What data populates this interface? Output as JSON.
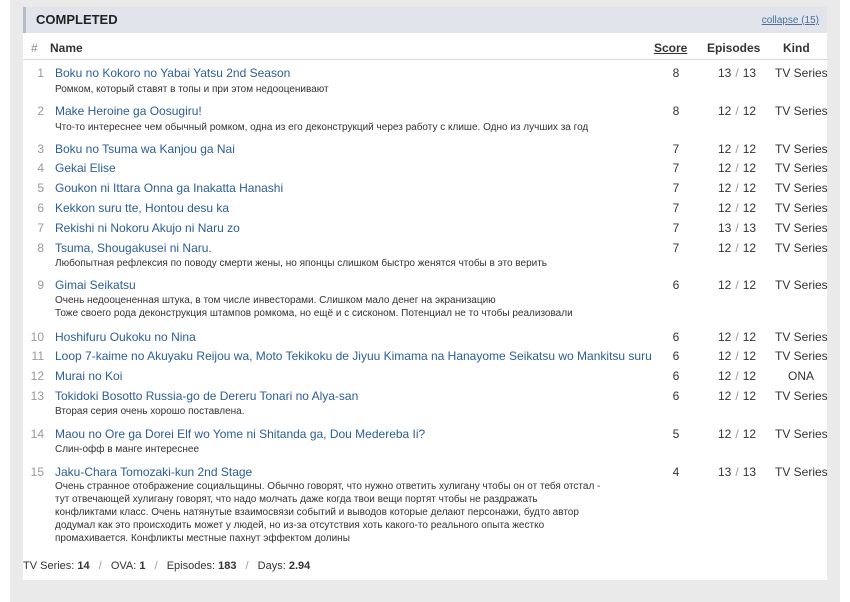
{
  "section": {
    "title": "COMPLETED",
    "collapse_label": "collapse (15)"
  },
  "columns": {
    "num": "#",
    "name": "Name",
    "score": "Score",
    "episodes": "Episodes",
    "kind": "Kind"
  },
  "episodes_sep": "/",
  "rows": [
    {
      "num": "1",
      "name": "Boku no Kokoro no Yabai Yatsu 2nd Season",
      "comment": "Ромком, который ставят в топы и при этом недооценивают",
      "score": "8",
      "watched": "13",
      "total": "13",
      "kind": "TV Series"
    },
    {
      "num": "2",
      "name": "Make Heroine ga Oosugiru!",
      "comment": "Что-то интереснее чем обычный ромком, одна из его деконструкций через работу с клише. Одно из лучших за год",
      "score": "8",
      "watched": "12",
      "total": "12",
      "kind": "TV Series"
    },
    {
      "num": "3",
      "name": "Boku no Tsuma wa Kanjou ga Nai",
      "comment": "",
      "score": "7",
      "watched": "12",
      "total": "12",
      "kind": "TV Series"
    },
    {
      "num": "4",
      "name": "Gekai Elise",
      "comment": "",
      "score": "7",
      "watched": "12",
      "total": "12",
      "kind": "TV Series"
    },
    {
      "num": "5",
      "name": "Goukon ni Ittara Onna ga Inakatta Hanashi",
      "comment": "",
      "score": "7",
      "watched": "12",
      "total": "12",
      "kind": "TV Series"
    },
    {
      "num": "6",
      "name": "Kekkon suru tte, Hontou desu ka",
      "comment": "",
      "score": "7",
      "watched": "12",
      "total": "12",
      "kind": "TV Series"
    },
    {
      "num": "7",
      "name": "Rekishi ni Nokoru Akujo ni Naru zo",
      "comment": "",
      "score": "7",
      "watched": "13",
      "total": "13",
      "kind": "TV Series"
    },
    {
      "num": "8",
      "name": "Tsuma, Shougakusei ni Naru.",
      "comment": "Любопытная рефлексия по поводу смерти жены, но японцы слишком быстро женятся чтобы в это верить",
      "score": "7",
      "watched": "12",
      "total": "12",
      "kind": "TV Series"
    },
    {
      "num": "9",
      "name": "Gimai Seikatsu",
      "comment": "Очень недооцененная штука, в том числе инвесторами. Слишком мало денег на экранизацию\nТоже своего рода деконструкция штампов ромкома, но ещё и с сисконом. Потенциал не то чтобы реализовали",
      "score": "6",
      "watched": "12",
      "total": "12",
      "kind": "TV Series"
    },
    {
      "num": "10",
      "name": "Hoshifuru Oukoku no Nina",
      "comment": "",
      "score": "6",
      "watched": "12",
      "total": "12",
      "kind": "TV Series"
    },
    {
      "num": "11",
      "name": "Loop 7-kaime no Akuyaku Reijou wa, Moto Tekikoku de Jiyuu Kimama na Hanayome Seikatsu wo Mankitsu suru",
      "comment": "",
      "score": "6",
      "watched": "12",
      "total": "12",
      "kind": "TV Series"
    },
    {
      "num": "12",
      "name": "Murai no Koi",
      "comment": "",
      "score": "6",
      "watched": "12",
      "total": "12",
      "kind": "ONA"
    },
    {
      "num": "13",
      "name": "Tokidoki Bosotto Russia-go de Dereru Tonari no Alya-san",
      "comment": "Вторая серия очень хорошо поставлена.",
      "score": "6",
      "watched": "12",
      "total": "12",
      "kind": "TV Series"
    },
    {
      "num": "14",
      "name": "Maou no Ore ga Dorei Elf wo Yome ni Shitanda ga, Dou Medereba Ii?",
      "comment": "Слин-офф в манге интереснее",
      "score": "5",
      "watched": "12",
      "total": "12",
      "kind": "TV Series"
    },
    {
      "num": "15",
      "name": "Jaku-Chara Tomozaki-kun 2nd Stage",
      "comment": "Очень странное отображение социальщины. Обычно говорят, что нужно ответить хулигану чтобы он от тебя отстал -\nтут отвечающей хулигану говорят, что надо молчать даже когда твои вещи портят чтобы не раздражать\nконфликтами класс. Очень натянутые взаимосвязи событий и выводов которые делают персонажи, будто автор\nдодумал как это происходить может у людей, но из-за отсутствия хоть какого-то реального опыта жестко\nпромахивается. Конфликты местные пахнут эффектом долины",
      "score": "4",
      "watched": "13",
      "total": "13",
      "kind": "TV Series"
    }
  ],
  "footer": {
    "tv_label": "TV Series:",
    "tv_value": "14",
    "ova_label": "OVA:",
    "ova_value": "1",
    "episodes_label": "Episodes:",
    "episodes_value": "183",
    "days_label": "Days:",
    "days_value": "2.94",
    "sep": "/"
  }
}
